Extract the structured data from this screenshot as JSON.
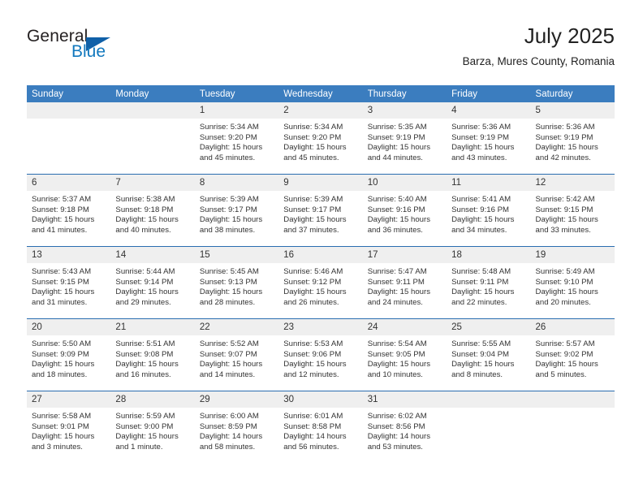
{
  "brand": {
    "name_part1": "General",
    "name_part2": "Blue",
    "accent_color": "#1278be",
    "triangle_color": "#1060a8",
    "triangle_icon": "triangle-icon"
  },
  "header": {
    "title": "July 2025",
    "subtitle": "Barza, Mures County, Romania"
  },
  "theme": {
    "header_blue": "#3b7dbf",
    "divider_blue": "#2a6db0",
    "daynum_band": "#efefef"
  },
  "calendar": {
    "weekday_headers": [
      "Sunday",
      "Monday",
      "Tuesday",
      "Wednesday",
      "Thursday",
      "Friday",
      "Saturday"
    ],
    "weeks": [
      [
        {
          "day": "",
          "sunrise": "",
          "sunset": "",
          "daylight_line1": "",
          "daylight_line2": ""
        },
        {
          "day": "",
          "sunrise": "",
          "sunset": "",
          "daylight_line1": "",
          "daylight_line2": ""
        },
        {
          "day": "1",
          "sunrise": "Sunrise: 5:34 AM",
          "sunset": "Sunset: 9:20 PM",
          "daylight_line1": "Daylight: 15 hours",
          "daylight_line2": "and 45 minutes."
        },
        {
          "day": "2",
          "sunrise": "Sunrise: 5:34 AM",
          "sunset": "Sunset: 9:20 PM",
          "daylight_line1": "Daylight: 15 hours",
          "daylight_line2": "and 45 minutes."
        },
        {
          "day": "3",
          "sunrise": "Sunrise: 5:35 AM",
          "sunset": "Sunset: 9:19 PM",
          "daylight_line1": "Daylight: 15 hours",
          "daylight_line2": "and 44 minutes."
        },
        {
          "day": "4",
          "sunrise": "Sunrise: 5:36 AM",
          "sunset": "Sunset: 9:19 PM",
          "daylight_line1": "Daylight: 15 hours",
          "daylight_line2": "and 43 minutes."
        },
        {
          "day": "5",
          "sunrise": "Sunrise: 5:36 AM",
          "sunset": "Sunset: 9:19 PM",
          "daylight_line1": "Daylight: 15 hours",
          "daylight_line2": "and 42 minutes."
        }
      ],
      [
        {
          "day": "6",
          "sunrise": "Sunrise: 5:37 AM",
          "sunset": "Sunset: 9:18 PM",
          "daylight_line1": "Daylight: 15 hours",
          "daylight_line2": "and 41 minutes."
        },
        {
          "day": "7",
          "sunrise": "Sunrise: 5:38 AM",
          "sunset": "Sunset: 9:18 PM",
          "daylight_line1": "Daylight: 15 hours",
          "daylight_line2": "and 40 minutes."
        },
        {
          "day": "8",
          "sunrise": "Sunrise: 5:39 AM",
          "sunset": "Sunset: 9:17 PM",
          "daylight_line1": "Daylight: 15 hours",
          "daylight_line2": "and 38 minutes."
        },
        {
          "day": "9",
          "sunrise": "Sunrise: 5:39 AM",
          "sunset": "Sunset: 9:17 PM",
          "daylight_line1": "Daylight: 15 hours",
          "daylight_line2": "and 37 minutes."
        },
        {
          "day": "10",
          "sunrise": "Sunrise: 5:40 AM",
          "sunset": "Sunset: 9:16 PM",
          "daylight_line1": "Daylight: 15 hours",
          "daylight_line2": "and 36 minutes."
        },
        {
          "day": "11",
          "sunrise": "Sunrise: 5:41 AM",
          "sunset": "Sunset: 9:16 PM",
          "daylight_line1": "Daylight: 15 hours",
          "daylight_line2": "and 34 minutes."
        },
        {
          "day": "12",
          "sunrise": "Sunrise: 5:42 AM",
          "sunset": "Sunset: 9:15 PM",
          "daylight_line1": "Daylight: 15 hours",
          "daylight_line2": "and 33 minutes."
        }
      ],
      [
        {
          "day": "13",
          "sunrise": "Sunrise: 5:43 AM",
          "sunset": "Sunset: 9:15 PM",
          "daylight_line1": "Daylight: 15 hours",
          "daylight_line2": "and 31 minutes."
        },
        {
          "day": "14",
          "sunrise": "Sunrise: 5:44 AM",
          "sunset": "Sunset: 9:14 PM",
          "daylight_line1": "Daylight: 15 hours",
          "daylight_line2": "and 29 minutes."
        },
        {
          "day": "15",
          "sunrise": "Sunrise: 5:45 AM",
          "sunset": "Sunset: 9:13 PM",
          "daylight_line1": "Daylight: 15 hours",
          "daylight_line2": "and 28 minutes."
        },
        {
          "day": "16",
          "sunrise": "Sunrise: 5:46 AM",
          "sunset": "Sunset: 9:12 PM",
          "daylight_line1": "Daylight: 15 hours",
          "daylight_line2": "and 26 minutes."
        },
        {
          "day": "17",
          "sunrise": "Sunrise: 5:47 AM",
          "sunset": "Sunset: 9:11 PM",
          "daylight_line1": "Daylight: 15 hours",
          "daylight_line2": "and 24 minutes."
        },
        {
          "day": "18",
          "sunrise": "Sunrise: 5:48 AM",
          "sunset": "Sunset: 9:11 PM",
          "daylight_line1": "Daylight: 15 hours",
          "daylight_line2": "and 22 minutes."
        },
        {
          "day": "19",
          "sunrise": "Sunrise: 5:49 AM",
          "sunset": "Sunset: 9:10 PM",
          "daylight_line1": "Daylight: 15 hours",
          "daylight_line2": "and 20 minutes."
        }
      ],
      [
        {
          "day": "20",
          "sunrise": "Sunrise: 5:50 AM",
          "sunset": "Sunset: 9:09 PM",
          "daylight_line1": "Daylight: 15 hours",
          "daylight_line2": "and 18 minutes."
        },
        {
          "day": "21",
          "sunrise": "Sunrise: 5:51 AM",
          "sunset": "Sunset: 9:08 PM",
          "daylight_line1": "Daylight: 15 hours",
          "daylight_line2": "and 16 minutes."
        },
        {
          "day": "22",
          "sunrise": "Sunrise: 5:52 AM",
          "sunset": "Sunset: 9:07 PM",
          "daylight_line1": "Daylight: 15 hours",
          "daylight_line2": "and 14 minutes."
        },
        {
          "day": "23",
          "sunrise": "Sunrise: 5:53 AM",
          "sunset": "Sunset: 9:06 PM",
          "daylight_line1": "Daylight: 15 hours",
          "daylight_line2": "and 12 minutes."
        },
        {
          "day": "24",
          "sunrise": "Sunrise: 5:54 AM",
          "sunset": "Sunset: 9:05 PM",
          "daylight_line1": "Daylight: 15 hours",
          "daylight_line2": "and 10 minutes."
        },
        {
          "day": "25",
          "sunrise": "Sunrise: 5:55 AM",
          "sunset": "Sunset: 9:04 PM",
          "daylight_line1": "Daylight: 15 hours",
          "daylight_line2": "and 8 minutes."
        },
        {
          "day": "26",
          "sunrise": "Sunrise: 5:57 AM",
          "sunset": "Sunset: 9:02 PM",
          "daylight_line1": "Daylight: 15 hours",
          "daylight_line2": "and 5 minutes."
        }
      ],
      [
        {
          "day": "27",
          "sunrise": "Sunrise: 5:58 AM",
          "sunset": "Sunset: 9:01 PM",
          "daylight_line1": "Daylight: 15 hours",
          "daylight_line2": "and 3 minutes."
        },
        {
          "day": "28",
          "sunrise": "Sunrise: 5:59 AM",
          "sunset": "Sunset: 9:00 PM",
          "daylight_line1": "Daylight: 15 hours",
          "daylight_line2": "and 1 minute."
        },
        {
          "day": "29",
          "sunrise": "Sunrise: 6:00 AM",
          "sunset": "Sunset: 8:59 PM",
          "daylight_line1": "Daylight: 14 hours",
          "daylight_line2": "and 58 minutes."
        },
        {
          "day": "30",
          "sunrise": "Sunrise: 6:01 AM",
          "sunset": "Sunset: 8:58 PM",
          "daylight_line1": "Daylight: 14 hours",
          "daylight_line2": "and 56 minutes."
        },
        {
          "day": "31",
          "sunrise": "Sunrise: 6:02 AM",
          "sunset": "Sunset: 8:56 PM",
          "daylight_line1": "Daylight: 14 hours",
          "daylight_line2": "and 53 minutes."
        },
        {
          "day": "",
          "sunrise": "",
          "sunset": "",
          "daylight_line1": "",
          "daylight_line2": ""
        },
        {
          "day": "",
          "sunrise": "",
          "sunset": "",
          "daylight_line1": "",
          "daylight_line2": ""
        }
      ]
    ]
  }
}
